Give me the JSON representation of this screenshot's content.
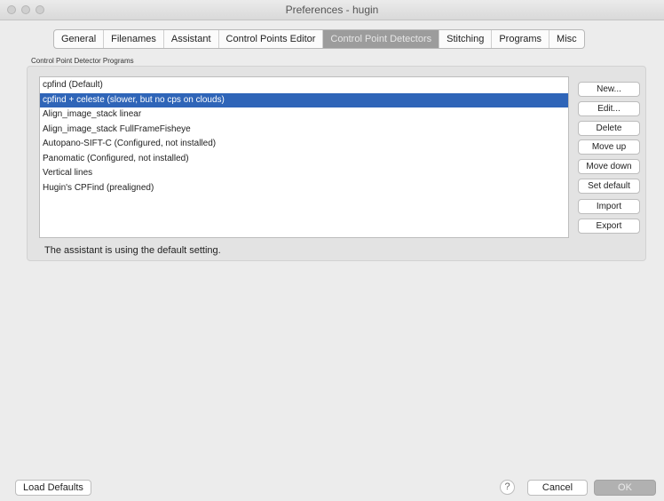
{
  "window": {
    "title": "Preferences - hugin"
  },
  "tabs": [
    {
      "label": "General",
      "active": false
    },
    {
      "label": "Filenames",
      "active": false
    },
    {
      "label": "Assistant",
      "active": false
    },
    {
      "label": "Control Points Editor",
      "active": false
    },
    {
      "label": "Control Point Detectors",
      "active": true
    },
    {
      "label": "Stitching",
      "active": false
    },
    {
      "label": "Programs",
      "active": false
    },
    {
      "label": "Misc",
      "active": false
    }
  ],
  "group": {
    "title": "Control Point Detector Programs"
  },
  "detectors": [
    {
      "label": "cpfind (Default)",
      "selected": false
    },
    {
      "label": "cpfind + celeste (slower, but no cps on clouds)",
      "selected": true
    },
    {
      "label": "Align_image_stack linear",
      "selected": false
    },
    {
      "label": "Align_image_stack FullFrameFisheye",
      "selected": false
    },
    {
      "label": "Autopano-SIFT-C (Configured, not installed)",
      "selected": false
    },
    {
      "label": "Panomatic (Configured, not installed)",
      "selected": false
    },
    {
      "label": "Vertical lines",
      "selected": false
    },
    {
      "label": "Hugin's CPFind (prealigned)",
      "selected": false
    }
  ],
  "side_buttons": {
    "new": "New...",
    "edit": "Edit...",
    "delete": "Delete",
    "move_up": "Move up",
    "move_down": "Move down",
    "set_default": "Set default",
    "import": "Import",
    "export": "Export"
  },
  "status_text": "The assistant is using the default setting.",
  "footer": {
    "load_defaults": "Load Defaults",
    "help": "?",
    "cancel": "Cancel",
    "ok": "OK"
  }
}
